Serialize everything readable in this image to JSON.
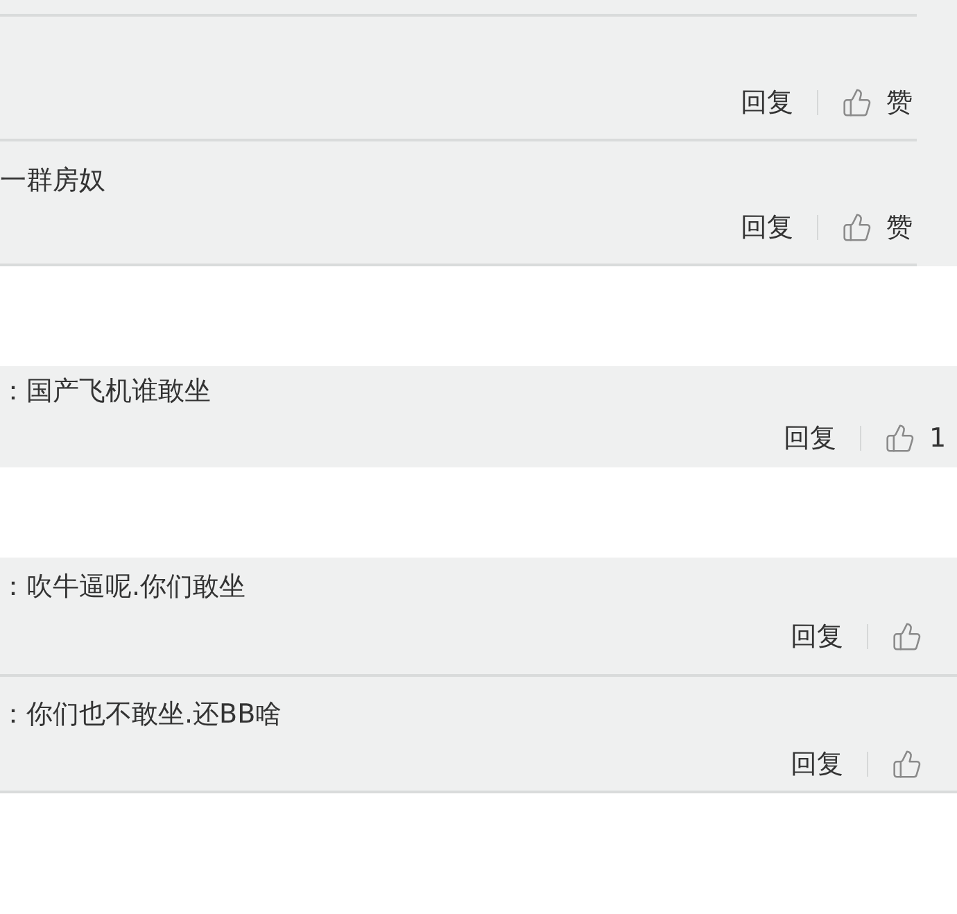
{
  "panels": [
    {
      "comments": [
        {
          "reply": "回复",
          "like": "赞"
        },
        {
          "text": "一群房奴",
          "reply": "回复",
          "like": "赞"
        }
      ]
    },
    {
      "comments": [
        {
          "text": "：国产飞机谁敢坐",
          "reply": "回复",
          "like": "1"
        }
      ]
    },
    {
      "comments": [
        {
          "text": "：吹牛逼呢.你们敢坐",
          "reply": "回复"
        },
        {
          "text": "：你们也不敢坐.还BB啥",
          "reply": "回复"
        }
      ]
    }
  ]
}
